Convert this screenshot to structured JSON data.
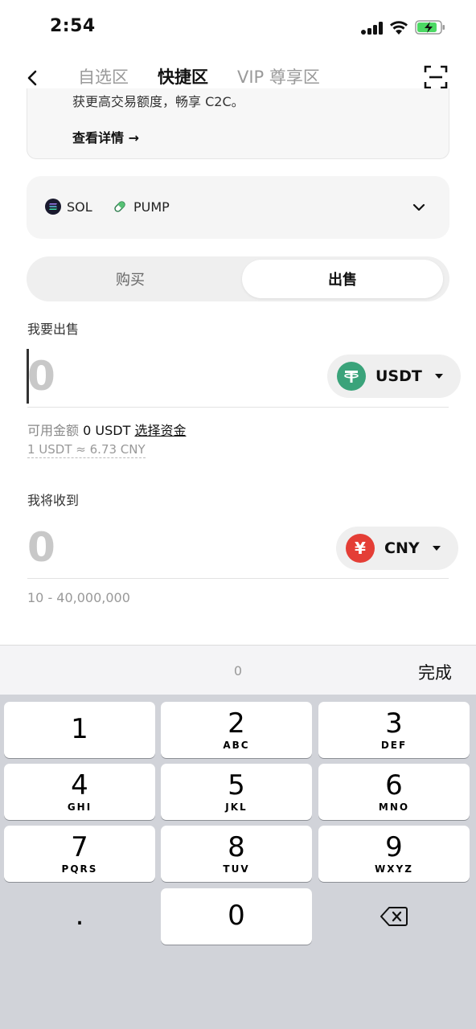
{
  "status_bar": {
    "time": "2:54"
  },
  "header": {
    "tabs": [
      {
        "label": "自选区",
        "active": false
      },
      {
        "label": "快捷区",
        "active": true
      },
      {
        "label": "VIP 尊享区",
        "active": false
      }
    ]
  },
  "promo": {
    "text": "获更高交易额度，畅享 C2C。",
    "link": "查看详情 →"
  },
  "assets": [
    {
      "symbol": "SOL",
      "icon": "solana-icon"
    },
    {
      "symbol": "PUMP",
      "icon": "pill-icon"
    }
  ],
  "trade_toggle": {
    "buy": "购买",
    "sell": "出售",
    "selected": "sell"
  },
  "sell_section": {
    "label": "我要出售",
    "placeholder": "0",
    "currency": "USDT",
    "available_label": "可用金额",
    "available_value": "0 USDT",
    "select_funds": "选择资金",
    "rate": "1 USDT ≈ 6.73 CNY"
  },
  "receive_section": {
    "label": "我将收到",
    "placeholder": "0",
    "currency": "CNY",
    "currency_symbol": "¥",
    "range": "10 - 40,000,000"
  },
  "keyboard": {
    "preview": "0",
    "done": "完成",
    "keys": [
      {
        "digit": "1",
        "letters": ""
      },
      {
        "digit": "2",
        "letters": "ABC"
      },
      {
        "digit": "3",
        "letters": "DEF"
      },
      {
        "digit": "4",
        "letters": "GHI"
      },
      {
        "digit": "5",
        "letters": "JKL"
      },
      {
        "digit": "6",
        "letters": "MNO"
      },
      {
        "digit": "7",
        "letters": "PQRS"
      },
      {
        "digit": "8",
        "letters": "TUV"
      },
      {
        "digit": "9",
        "letters": "WXYZ"
      },
      {
        "digit": ".",
        "letters": ""
      },
      {
        "digit": "0",
        "letters": ""
      }
    ]
  },
  "colors": {
    "usdt": "#3aa37a",
    "cny": "#e43e36",
    "battery": "#4cd964"
  }
}
